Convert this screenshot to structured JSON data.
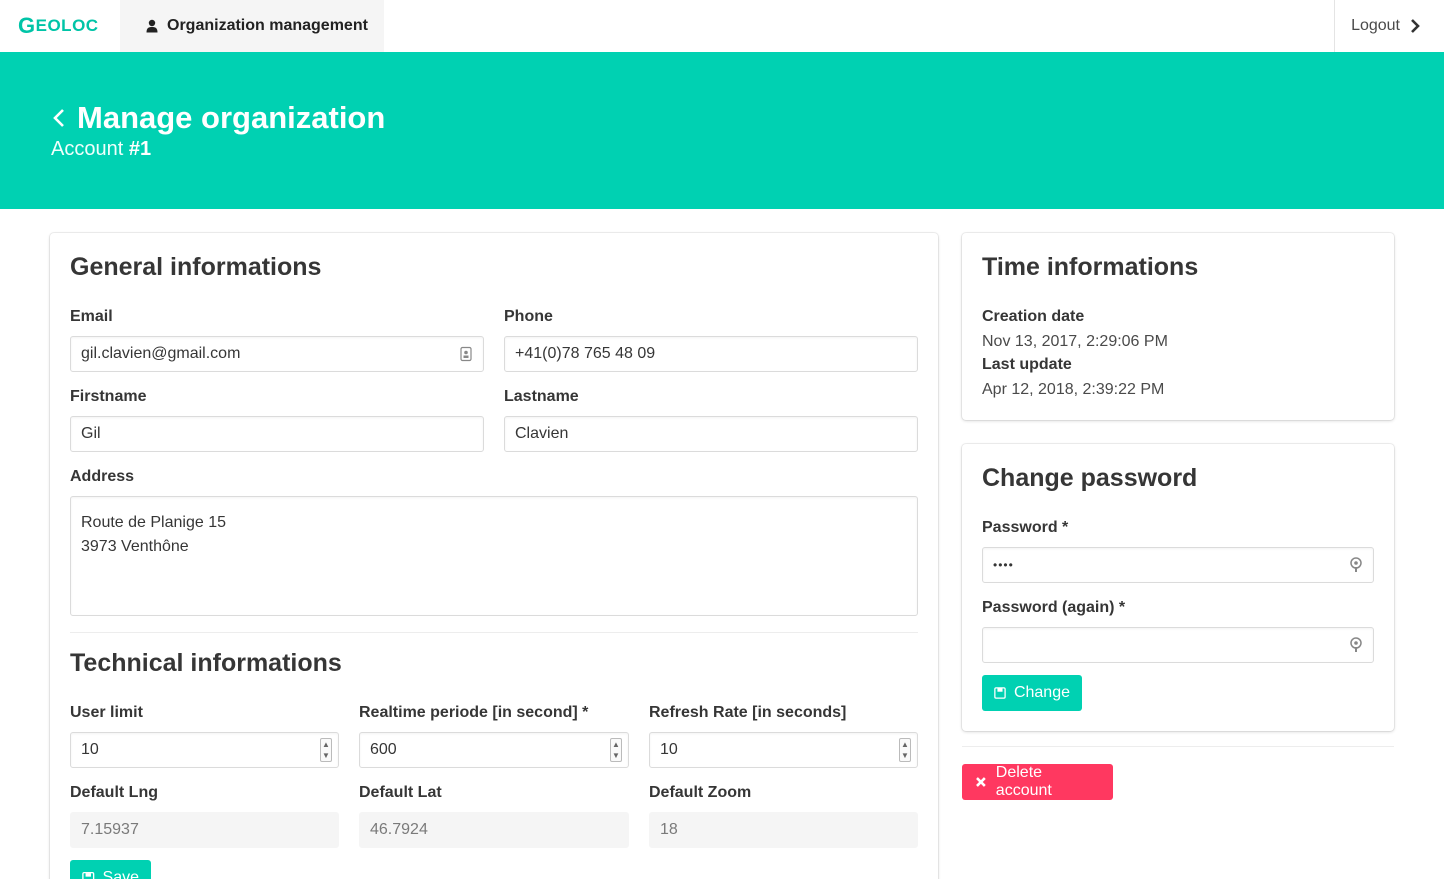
{
  "navbar": {
    "brand_first": "G",
    "brand_rest": "EOLOC",
    "active_item": "Organization management",
    "logout": "Logout"
  },
  "hero": {
    "title": "Manage organization",
    "subtitle_prefix": "Account",
    "subtitle_number": "#1"
  },
  "general": {
    "title": "General informations",
    "email_label": "Email",
    "email_value": "gil.clavien@gmail.com",
    "phone_label": "Phone",
    "phone_value": "+41(0)78 765 48 09",
    "firstname_label": "Firstname",
    "firstname_value": "Gil",
    "lastname_label": "Lastname",
    "lastname_value": "Clavien",
    "address_label": "Address",
    "address_line1": "Route de Planige 15",
    "address_line2": "3973 Venthône"
  },
  "technical": {
    "title": "Technical informations",
    "user_limit_label": "User limit",
    "user_limit_value": "10",
    "realtime_label": "Realtime periode [in second] *",
    "realtime_value": "600",
    "refresh_label": "Refresh Rate [in seconds]",
    "refresh_value": "10",
    "lng_label": "Default Lng",
    "lng_value": "7.15937",
    "lat_label": "Default Lat",
    "lat_value": "46.7924",
    "zoom_label": "Default Zoom",
    "zoom_value": "18",
    "save_label": "Save"
  },
  "time": {
    "title": "Time informations",
    "creation_label": "Creation date",
    "creation_value": "Nov 13, 2017, 2:29:06 PM",
    "update_label": "Last update",
    "update_value": "Apr 12, 2018, 2:39:22 PM"
  },
  "password": {
    "title": "Change password",
    "password_label": "Password *",
    "password_value": "••••",
    "password_again_label": "Password (again) *",
    "password_again_value": "",
    "change_label": "Change"
  },
  "danger": {
    "delete_label": "Delete account"
  },
  "colors": {
    "primary": "#00d1b2",
    "danger": "#ff3860"
  }
}
